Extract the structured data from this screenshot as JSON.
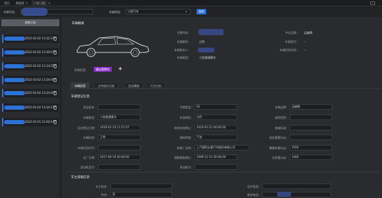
{
  "topbar": {
    "tabs": [
      "首页",
      "数据源",
      "一车一档"
    ],
    "close_glyph": "×"
  },
  "filter": {
    "plate_label": "车牌号码:",
    "vehicle_type_label": "车辆种类:",
    "vehicle_type_value": "小型汽车",
    "query_button": "查询"
  },
  "history": {
    "header": "查看记录",
    "items": [
      {
        "time": "2022-03-02 13:32:33"
      },
      {
        "time": "2022-03-02 13:30:07"
      },
      {
        "time": "2022-03-02 13:14:55"
      },
      {
        "time": "2022-03-02 13:34:00"
      },
      {
        "time": "2022-03-02 13:34:40"
      },
      {
        "time": "2022-03-02 13:34:21"
      },
      {
        "time": "2022-03-01 21:00:47"
      }
    ]
  },
  "overview": {
    "title": "车辆概要",
    "plate_label": "号牌号码:",
    "color_label": "车辆颜色:",
    "color_value": "白色",
    "owner_label": "车辆所有人:",
    "type_label": "车辆类型:",
    "type_value": "小型普通客车",
    "brand_label": "中文品牌:",
    "brand_value": "运输牌",
    "model_label": "车辆型号:",
    "model_value": "--",
    "vin_label": "车辆识别代码:",
    "vin_value": "--",
    "tag_label": "异常标签:",
    "tag_value": "疑似套牌车",
    "add_glyph": "+"
  },
  "subtabs": [
    "车辆信息",
    "过车统计记录",
    "违法事故",
    "行为分析"
  ],
  "registration": {
    "title": "车辆登记信息",
    "rows": [
      [
        [
          "发证机关:",
          ""
        ],
        [
          "号牌类型:",
          "02"
        ],
        [
          "车辆品牌:",
          "运输牌"
        ]
      ],
      [
        [
          "车辆类型:",
          "小型普通客车"
        ],
        [
          "车身颜色:",
          "白色"
        ],
        [
          "使用性质:",
          ""
        ]
      ],
      [
        [
          "初次登记日期:",
          "2016-01-10 11:57:47"
        ],
        [
          "检验有效期止:",
          "2024-01-31 00:00:00"
        ],
        [
          "排放标准:",
          ""
        ]
      ],
      [
        [
          "车辆状态:",
          "正常"
        ],
        [
          "燃料种类:",
          "汽油"
        ],
        [
          "核定载客(kg):",
          ""
        ]
      ],
      [
        [
          "车辆识别代号:",
          ""
        ],
        [
          "制造厂名称:",
          "上汽通用五菱汽车股份有限公司"
        ],
        [
          "整备质量(kg):",
          "1050"
        ]
      ],
      [
        [
          "出厂日期:",
          "2017-09-19 00:00:00"
        ],
        [
          "强制报废期止:",
          "2099-12-31 00:00:00"
        ],
        [
          "总质量(kg):",
          "1460"
        ]
      ],
      [
        [
          "发动机型号:",
          ""
        ],
        [
          "发动机号:",
          ""
        ],
        [
          "",
          ""
        ]
      ]
    ]
  },
  "owner": {
    "title": "车主基础信息",
    "name_label": "车主姓名:",
    "gender_label": "性别:",
    "gender_value": "男",
    "id_type_label": "证件类型:",
    "id_type_value": "",
    "phone_label": "联系电话:",
    "phone_value": ""
  }
}
